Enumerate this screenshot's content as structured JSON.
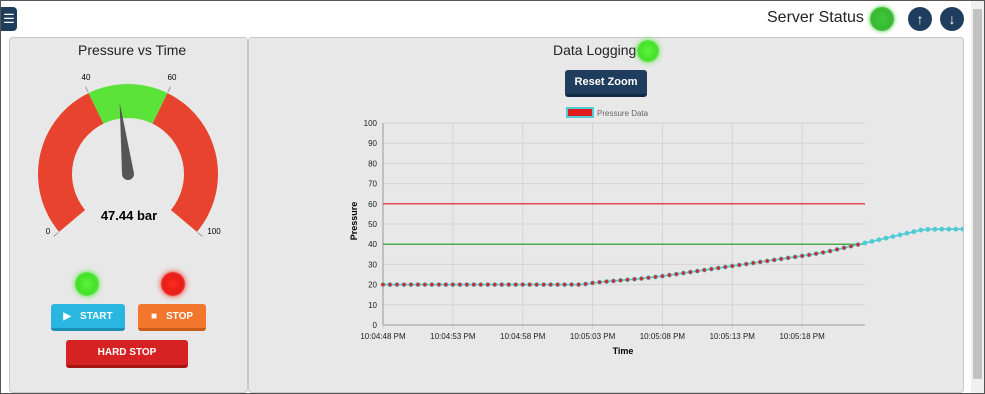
{
  "topbar": {
    "menu_icon": "☰",
    "server_status_label": "Server Status",
    "server_status_color": "#3fc93a",
    "up_icon": "↑",
    "down_icon": "↓"
  },
  "left_panel": {
    "title": "Pressure vs Time",
    "gauge": {
      "value_text": "47.44 bar",
      "value": 47.44,
      "min": 0,
      "max": 100,
      "tick_min": "0",
      "tick_40": "40",
      "tick_60": "60",
      "tick_max": "100",
      "band_low_color": "#e8432e",
      "band_mid_color": "#5be33a",
      "band_high_color": "#e8432e",
      "needle_color": "#555555"
    },
    "status_led_left": "green",
    "status_led_right": "red",
    "start_label": "START",
    "stop_label": "STOP",
    "hard_stop_label": "HARD STOP"
  },
  "right_panel": {
    "title": "Data Logging",
    "logging_led": "green",
    "reset_zoom_label": "Reset Zoom"
  },
  "chart_data": {
    "type": "line",
    "legend": [
      "Pressure Data"
    ],
    "xlabel": "Time",
    "ylabel": "Pressure",
    "ylim": [
      0,
      100
    ],
    "yticks": [
      "0",
      "10",
      "20",
      "30",
      "40",
      "50",
      "60",
      "70",
      "80",
      "90",
      "100"
    ],
    "xtick_labels": [
      "10:04:48 PM",
      "10:04:53 PM",
      "10:04:58 PM",
      "10:05:03 PM",
      "10:05:08 PM",
      "10:05:13 PM",
      "10:05:18 PM"
    ],
    "xlim_seconds": [
      0,
      34.5
    ],
    "thresholds": [
      {
        "value": 60,
        "color": "#e01b1b"
      },
      {
        "value": 40,
        "color": "#1a9a1a"
      }
    ],
    "series": [
      {
        "name": "Pressure Data",
        "line_color": "#4ecbd4",
        "marker_color_low": "#d22b2b",
        "marker_color_high": "#4ecbd4",
        "sample_interval_s": 0.5,
        "values": [
          20.0,
          20.0,
          20.0,
          20.0,
          20.0,
          20.0,
          20.0,
          20.0,
          20.0,
          20.0,
          20.0,
          20.0,
          20.0,
          20.0,
          20.0,
          20.0,
          20.0,
          20.0,
          20.0,
          20.0,
          20.0,
          20.0,
          20.0,
          20.0,
          20.0,
          20.0,
          20.0,
          20.0,
          20.0,
          20.3,
          20.8,
          21.2,
          21.5,
          21.8,
          22.1,
          22.4,
          22.7,
          23.0,
          23.4,
          23.8,
          24.2,
          24.7,
          25.2,
          25.7,
          26.2,
          26.7,
          27.2,
          27.7,
          28.2,
          28.7,
          29.2,
          29.7,
          30.2,
          30.7,
          31.2,
          31.7,
          32.2,
          32.7,
          33.2,
          33.7,
          34.2,
          34.7,
          35.3,
          35.9,
          36.6,
          37.4,
          38.2,
          39.0,
          39.8,
          40.6,
          41.4,
          42.2,
          43.0,
          43.8,
          44.6,
          45.4,
          46.2,
          47.0,
          47.3,
          47.4,
          47.44,
          47.44,
          47.44,
          47.44,
          47.44
        ]
      }
    ]
  }
}
